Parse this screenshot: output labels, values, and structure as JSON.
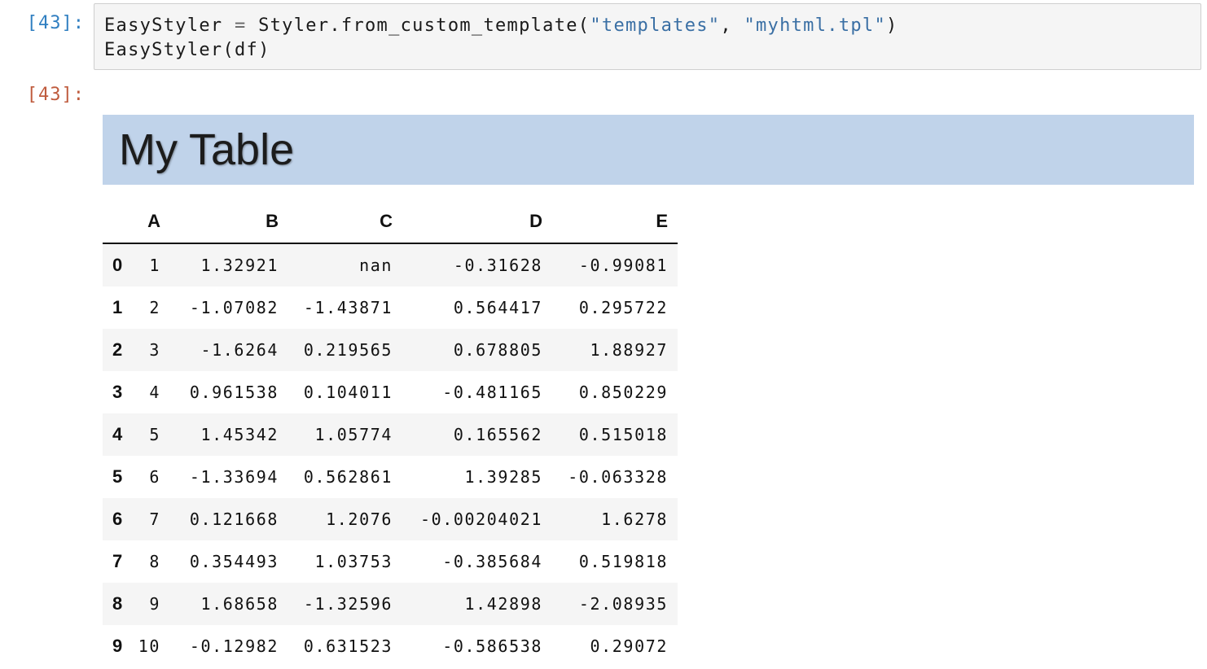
{
  "input_prompt": "[43]:",
  "output_prompt": "[43]:",
  "code": {
    "line1": {
      "name": "EasyStyler",
      "op": " = ",
      "call": "Styler.from_custom_template(",
      "arg1": "\"templates\"",
      "sep": ", ",
      "arg2": "\"myhtml.tpl\"",
      "close": ")"
    },
    "line2": "EasyStyler(df)"
  },
  "output": {
    "title": "My Table",
    "table": {
      "columns": [
        "A",
        "B",
        "C",
        "D",
        "E"
      ],
      "rows": [
        {
          "index": "0",
          "cells": [
            "1",
            "1.32921",
            "nan",
            "-0.31628",
            "-0.99081"
          ]
        },
        {
          "index": "1",
          "cells": [
            "2",
            "-1.07082",
            "-1.43871",
            "0.564417",
            "0.295722"
          ]
        },
        {
          "index": "2",
          "cells": [
            "3",
            "-1.6264",
            "0.219565",
            "0.678805",
            "1.88927"
          ]
        },
        {
          "index": "3",
          "cells": [
            "4",
            "0.961538",
            "0.104011",
            "-0.481165",
            "0.850229"
          ]
        },
        {
          "index": "4",
          "cells": [
            "5",
            "1.45342",
            "1.05774",
            "0.165562",
            "0.515018"
          ]
        },
        {
          "index": "5",
          "cells": [
            "6",
            "-1.33694",
            "0.562861",
            "1.39285",
            "-0.063328"
          ]
        },
        {
          "index": "6",
          "cells": [
            "7",
            "0.121668",
            "1.2076",
            "-0.00204021",
            "1.6278"
          ]
        },
        {
          "index": "7",
          "cells": [
            "8",
            "0.354493",
            "1.03753",
            "-0.385684",
            "0.519818"
          ]
        },
        {
          "index": "8",
          "cells": [
            "9",
            "1.68658",
            "-1.32596",
            "1.42898",
            "-2.08935"
          ]
        },
        {
          "index": "9",
          "cells": [
            "10",
            "-0.12982",
            "0.631523",
            "-0.586538",
            "0.29072"
          ]
        }
      ]
    }
  },
  "colors": {
    "input_prompt": "#307fc1",
    "output_prompt": "#bf5b3d",
    "string_token": "#3a6fa4",
    "title_background": "#c0d3ea",
    "cell_background": "#f5f5f5"
  }
}
